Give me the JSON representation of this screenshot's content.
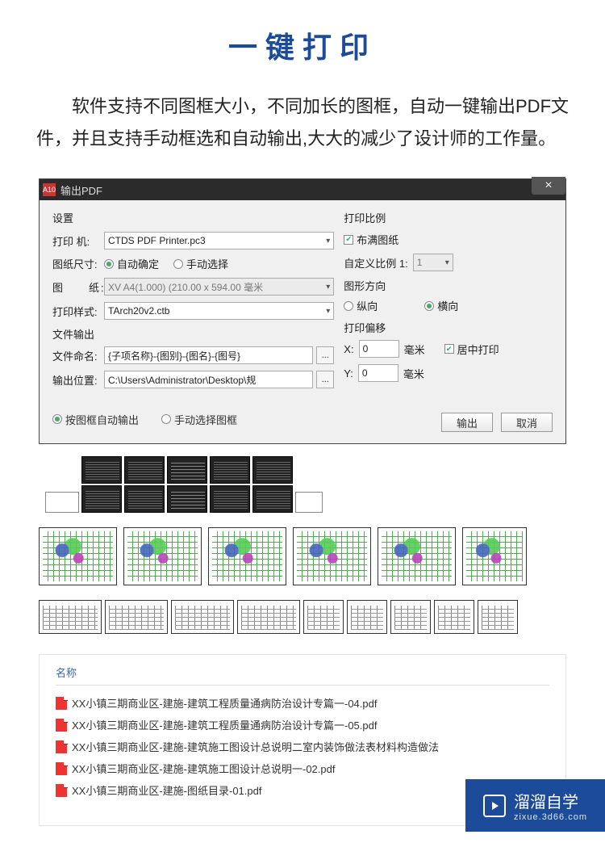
{
  "page": {
    "title": "一键打印",
    "description": "软件支持不同图框大小，不同加长的图框，自动一键输出PDF文件，并且支持手动框选和自动输出,大大的减少了设计师的工作量。"
  },
  "dialog": {
    "icon_label": "A10",
    "title": "输出PDF",
    "close": "×",
    "settings_label": "设置",
    "printer_label": "打印 机:",
    "printer_value": "CTDS PDF Printer.pc3",
    "papersize_label": "图纸尺寸:",
    "papersize_auto": "自动确定",
    "papersize_manual": "手动选择",
    "paper_label": "图　　纸:",
    "paper_value": "XV A4(1.000) (210.00 x 594.00 毫米",
    "plotstyle_label": "打印样式:",
    "plotstyle_value": "TArch20v2.ctb",
    "fileout_label": "文件输出",
    "filename_label": "文件命名:",
    "filename_value": "{子项名称}-{图别}-{图名}-{图号}",
    "outputpath_label": "输出位置:",
    "outputpath_value": "C:\\Users\\Administrator\\Desktop\\规",
    "browse_btn": "...",
    "scale_label": "打印比例",
    "fillpaper": "布满图纸",
    "customscale_label": "自定义比例  1:",
    "customscale_value": "1",
    "direction_label": "图形方向",
    "portrait": "纵向",
    "landscape": "横向",
    "offset_label": "打印偏移",
    "offset_x_label": "X:",
    "offset_x_value": "0",
    "offset_y_label": "Y:",
    "offset_y_value": "0",
    "offset_unit": "毫米",
    "center_on_paper": "居中打印",
    "output_by_frame": "按图框自动输出",
    "manual_select_frame": "手动选择图框",
    "export_btn": "输出",
    "cancel_btn": "取消"
  },
  "filelist": {
    "header": "名称",
    "items": [
      "XX小镇三期商业区-建施-建筑工程质量通病防治设计专篇一-04.pdf",
      "XX小镇三期商业区-建施-建筑工程质量通病防治设计专篇一-05.pdf",
      "XX小镇三期商业区-建施-建筑施工图设计总说明二室内装饰做法表材料构造做法",
      "XX小镇三期商业区-建施-建筑施工图设计总说明一-02.pdf",
      "XX小镇三期商业区-建施-图纸目录-01.pdf"
    ]
  },
  "watermark": {
    "main": "溜溜自学",
    "sub": "zixue.3d66.com"
  }
}
